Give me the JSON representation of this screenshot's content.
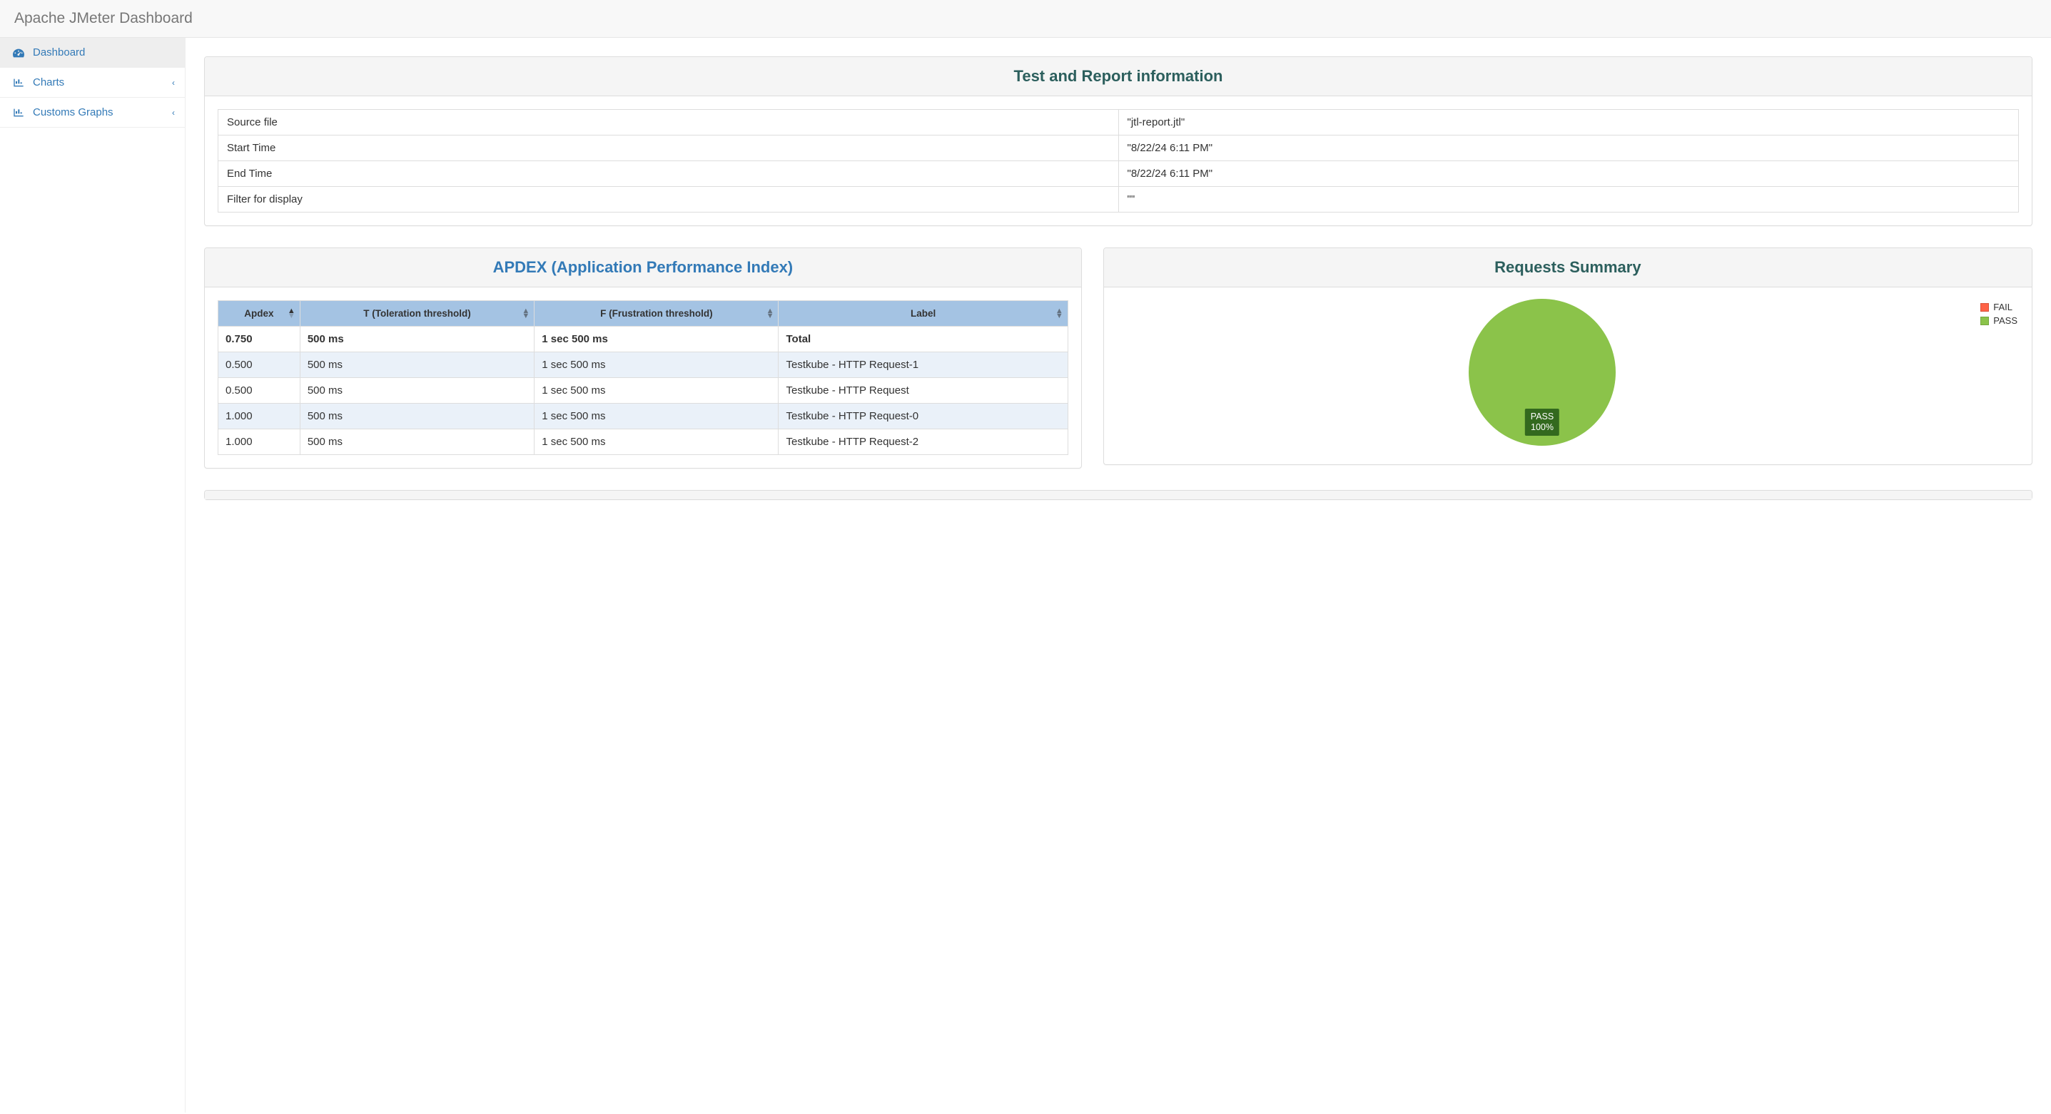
{
  "app_title": "Apache JMeter Dashboard",
  "sidebar": {
    "items": [
      {
        "label": "Dashboard",
        "icon": "tachometer-icon",
        "active": true,
        "has_children": false
      },
      {
        "label": "Charts",
        "icon": "bar-chart-icon",
        "active": false,
        "has_children": true
      },
      {
        "label": "Customs Graphs",
        "icon": "bar-chart-icon",
        "active": false,
        "has_children": true
      }
    ]
  },
  "info_panel": {
    "title": "Test and Report information",
    "rows": [
      {
        "label": "Source file",
        "value": "\"jtl-report.jtl\""
      },
      {
        "label": "Start Time",
        "value": "\"8/22/24 6:11 PM\""
      },
      {
        "label": "End Time",
        "value": "\"8/22/24 6:11 PM\""
      },
      {
        "label": "Filter for display",
        "value": "\"\""
      }
    ]
  },
  "apdex_panel": {
    "title": "APDEX (Application Performance Index)",
    "columns": [
      "Apdex",
      "T (Toleration threshold)",
      "F (Frustration threshold)",
      "Label"
    ],
    "total_row": {
      "apdex": "0.750",
      "t": "500 ms",
      "f": "1 sec 500 ms",
      "label": "Total"
    },
    "rows": [
      {
        "apdex": "0.500",
        "t": "500 ms",
        "f": "1 sec 500 ms",
        "label": "Testkube - HTTP Request-1"
      },
      {
        "apdex": "0.500",
        "t": "500 ms",
        "f": "1 sec 500 ms",
        "label": "Testkube - HTTP Request"
      },
      {
        "apdex": "1.000",
        "t": "500 ms",
        "f": "1 sec 500 ms",
        "label": "Testkube - HTTP Request-0"
      },
      {
        "apdex": "1.000",
        "t": "500 ms",
        "f": "1 sec 500 ms",
        "label": "Testkube - HTTP Request-2"
      }
    ]
  },
  "requests_panel": {
    "title": "Requests Summary",
    "legend": {
      "fail": "FAIL",
      "pass": "PASS"
    },
    "slice_label_name": "PASS",
    "slice_label_pct": "100%"
  },
  "chart_data": {
    "type": "pie",
    "title": "Requests Summary",
    "series": [
      {
        "name": "FAIL",
        "value": 0,
        "color": "#ff6347"
      },
      {
        "name": "PASS",
        "value": 100,
        "color": "#8bc34a"
      }
    ]
  }
}
